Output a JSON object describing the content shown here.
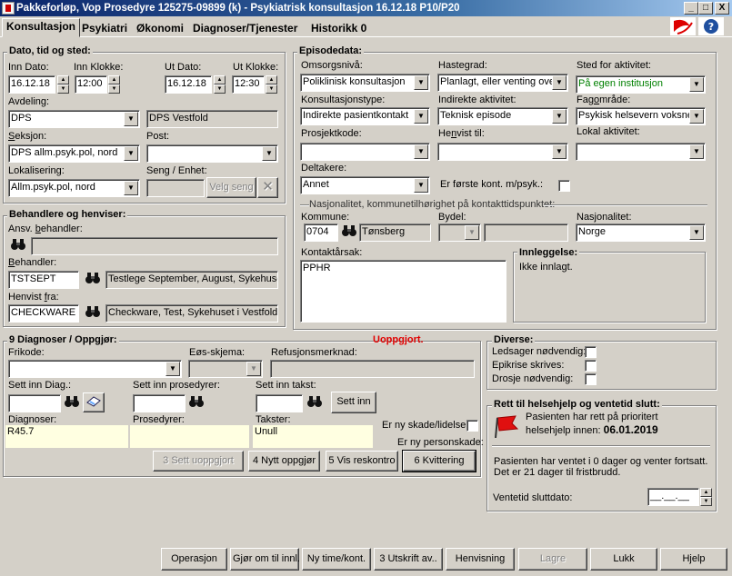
{
  "window": {
    "title": "Pakkeforløp, Vop Prosedyre  125275-09899 (k) - Psykiatrisk konsultasjon 16.12.18 P10/P20",
    "controls": {
      "minimize": "_",
      "maximize": "□",
      "close": "X"
    }
  },
  "tabs": [
    "Konsultasjon",
    "Psykiatri",
    "Økonomi",
    "Diagnoser/Tjenester",
    "Historikk 0"
  ],
  "dato": {
    "title": "Dato, tid og sted:",
    "inn_dato_label": "Inn Dato:",
    "inn_dato": "16.12.18",
    "inn_klokke_label": "Inn Klokke:",
    "inn_klokke": "12:00",
    "ut_dato_label": "Ut Dato:",
    "ut_dato": "16.12.18",
    "ut_klokke_label": "Ut Klokke:",
    "ut_klokke": "12:30",
    "avdeling_label": "Avdeling:",
    "avdeling": "DPS",
    "avdeling_name": "DPS Vestfold",
    "seksjon_label": "Seksjon:",
    "seksjon": "DPS allm.psyk.pol, nord",
    "post_label": "Post:",
    "post": "",
    "lokalisering_label": "Lokalisering:",
    "lokalisering": "Allm.psyk.pol, nord",
    "seng_label": "Seng / Enhet:",
    "seng": "",
    "velg_seng": "Velg seng"
  },
  "behandlere": {
    "title": "Behandlere og henviser:",
    "ansv_label": "Ansv. behandler:",
    "ansv": "",
    "behandler_label": "Behandler:",
    "behandler_code": "TSTSEPT",
    "behandler_name": "Testlege September, August, Sykehuset",
    "henvist_label": "Henvist fra:",
    "henvist_code": "CHECKWARE",
    "henvist_name": "Checkware, Test, Sykehuset i Vestfold"
  },
  "episode": {
    "title": "Episodedata:",
    "omsorgsniva_label": "Omsorgsnivå:",
    "omsorgsniva": "Poliklinisk konsultasjon",
    "hastegrad_label": "Hastegrad:",
    "hastegrad": "Planlagt, eller venting ove",
    "sted_label": "Sted for aktivitet:",
    "sted": "På egen institusjon",
    "konsultasjonstype_label": "Konsultasjonstype:",
    "konsultasjonstype": "Indirekte pasientkontakt",
    "indirekte_label": "Indirekte aktivitet:",
    "indirekte": "Teknisk episode",
    "fagomrade_label": "Fagområde:",
    "fagomrade": "Psykisk helsevern voksne",
    "prosjektkode_label": "Prosjektkode:",
    "prosjektkode": "",
    "henvist_til_label": "Henvist til:",
    "henvist_til": "",
    "lokal_label": "Lokal aktivitet:",
    "lokal": "",
    "deltakere_label": "Deltakere:",
    "deltakere": "Annet",
    "forste_kont_label": "Er første kont. m/psyk.:",
    "nasjonalitet_title": "Nasjonalitet, kommunetilhørighet på kontakttidspunktet:",
    "kommune_label": "Kommune:",
    "kommune_code": "0704",
    "kommune_name": "Tønsberg",
    "bydel_label": "Bydel:",
    "bydel": "",
    "nasjonalitet_label": "Nasjonalitet:",
    "nasjonalitet": "Norge",
    "kontaktarsak_label": "Kontaktårsak:",
    "kontaktarsak": "PPHR",
    "innleggelse_label": "Innleggelse:",
    "innleggelse": "Ikke innlagt."
  },
  "diagnoser": {
    "title": "9 Diagnoser / Oppgjør:",
    "status": "Uoppgjort.",
    "frikode_label": "Frikode:",
    "frikode": "",
    "eos_label": "Eøs-skjema:",
    "eos": "",
    "refusjon_label": "Refusjonsmerknad:",
    "refusjon": "",
    "sett_diag_label": "Sett inn Diag.:",
    "sett_prosedyrer_label": "Sett inn prosedyrer:",
    "sett_takst_label": "Sett inn takst:",
    "sett_inn_btn": "Sett inn",
    "diagnoser_label": "Diagnoser:",
    "diagnoser": "R45.7",
    "prosedyrer_label": "Prosedyrer:",
    "prosedyrer": "",
    "takster_label": "Takster:",
    "takster": "Unull",
    "skade_label": "Er ny skade/lidelse",
    "personskade_label": "Er ny personskade:",
    "btn_sett_uoppgjort": "3 Sett uoppgjort",
    "btn_nytt_oppgjor": "4 Nytt oppgjør",
    "btn_vis_reskontro": "5 Vis reskontro",
    "btn_kvittering": "6 Kvittering"
  },
  "diverse": {
    "title": "Diverse:",
    "ledsager": "Ledsager nødvendig:",
    "epikrise": "Epikrise skrives:",
    "drosje": "Drosje nødvendig:"
  },
  "rett": {
    "title": "Rett til helsehjelp og ventetid slutt:",
    "text1": "Pasienten har rett på prioritert",
    "text2": "helsehjelp innen:",
    "date": "06.01.2019",
    "ventet1": "Pasienten har ventet i 0 dager og venter fortsatt.",
    "ventet2": "Det er 21 dager til fristbrudd.",
    "ventetid_label": "Ventetid sluttdato:",
    "ventetid": "__.__.__"
  },
  "footer": {
    "operasjon": "Operasjon",
    "gjor_om": "Gjør om til innl.",
    "ny_time": "Ny time/kont.",
    "utskrift": "3 Utskrift av..",
    "henvisning": "Henvisning",
    "lagre": "Lagre",
    "lukk": "Lukk",
    "hjelp": "Hjelp"
  },
  "colors": {
    "titlebar": "#0a246a",
    "status_red": "#e00000",
    "sted_green": "#008000",
    "yellow_field": "#ffffe1"
  }
}
